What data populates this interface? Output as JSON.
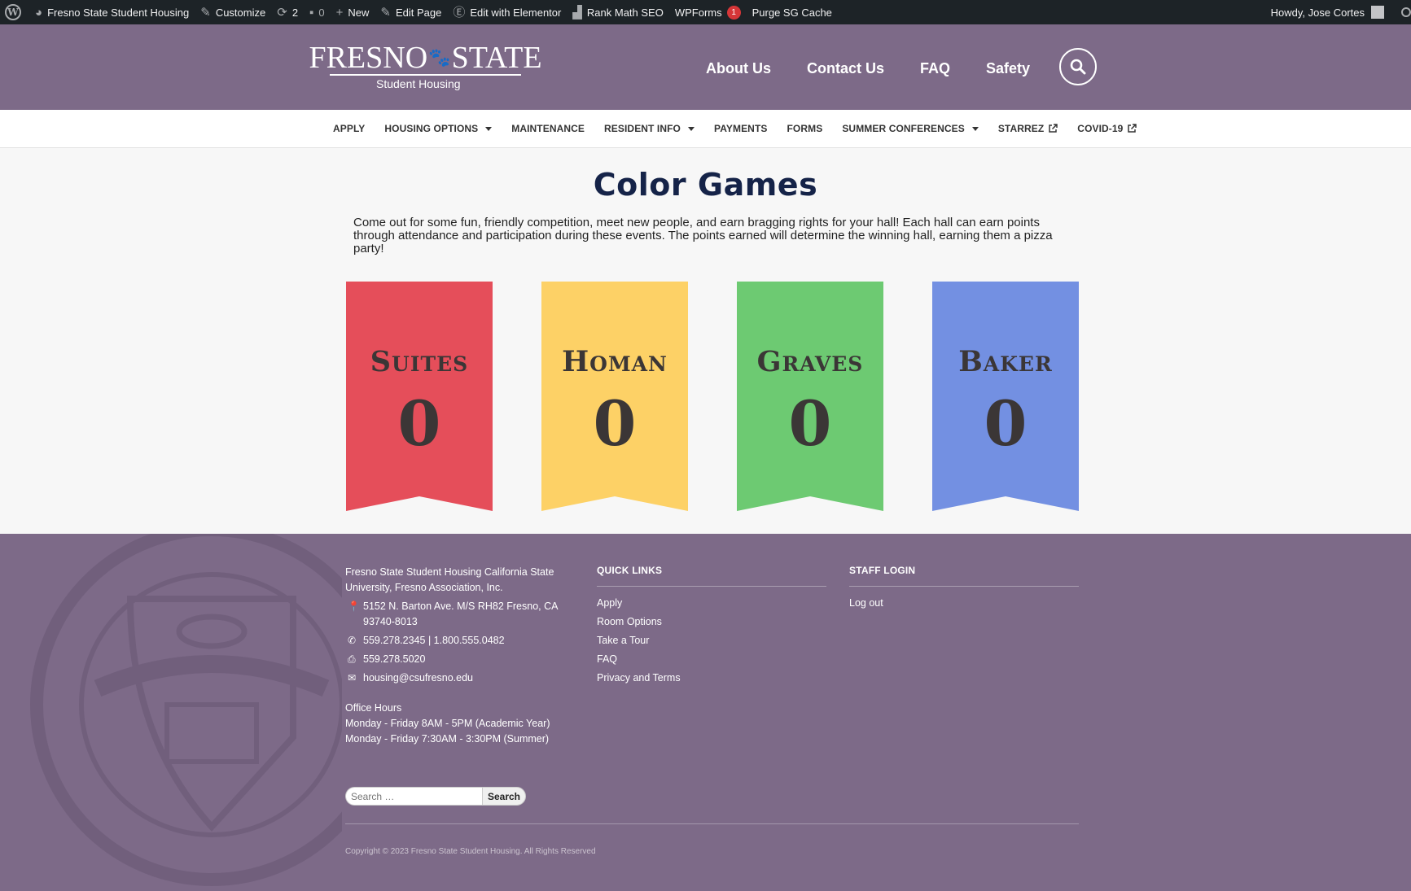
{
  "adminbar": {
    "site_name": "Fresno State Student Housing",
    "customize": "Customize",
    "updates_count": "2",
    "comments_count": "0",
    "new": "New",
    "edit_page": "Edit Page",
    "elementor": "Edit with Elementor",
    "rankmath": "Rank Math SEO",
    "wpforms": "WPForms",
    "wpforms_badge": "1",
    "purge": "Purge SG Cache",
    "howdy": "Howdy, Jose Cortes"
  },
  "logo": {
    "wordmark_left": "FRESNO",
    "wordmark_right": "STATE",
    "sub": "Student Housing"
  },
  "mainnav": [
    "About Us",
    "Contact Us",
    "FAQ",
    "Safety"
  ],
  "subnav": [
    {
      "label": "APPLY",
      "caret": false,
      "ext": false
    },
    {
      "label": "HOUSING OPTIONS",
      "caret": true,
      "ext": false
    },
    {
      "label": "MAINTENANCE",
      "caret": false,
      "ext": false
    },
    {
      "label": "RESIDENT INFO",
      "caret": true,
      "ext": false
    },
    {
      "label": "PAYMENTS",
      "caret": false,
      "ext": false
    },
    {
      "label": "FORMS",
      "caret": false,
      "ext": false
    },
    {
      "label": "SUMMER CONFERENCES",
      "caret": true,
      "ext": false
    },
    {
      "label": "STARREZ",
      "caret": false,
      "ext": true
    },
    {
      "label": "COVID-19",
      "caret": false,
      "ext": true
    }
  ],
  "page": {
    "title": "Color Games",
    "intro": "Come out for some fun, friendly competition, meet new people, and earn bragging rights for your hall! Each hall can earn points through attendance and participation during these events. The points earned will determine the winning hall, earning them a pizza party!"
  },
  "halls": [
    {
      "name": "Suites",
      "score": "0",
      "color": "#e54e5a"
    },
    {
      "name": "Homan",
      "score": "0",
      "color": "#fdd166"
    },
    {
      "name": "Graves",
      "score": "0",
      "color": "#6dca72"
    },
    {
      "name": "Baker",
      "score": "0",
      "color": "#7390e2"
    }
  ],
  "footer": {
    "org": "Fresno State Student Housing California State University, Fresno Association, Inc.",
    "address": "5152 N. Barton Ave. M/S RH82 Fresno, CA 93740-8013",
    "phone": "559.278.2345 | 1.800.555.0482",
    "fax": "559.278.5020",
    "email": "housing@csufresno.edu",
    "hours_title": "Office Hours",
    "hours_1": "Monday - Friday 8AM - 5PM (Academic Year)",
    "hours_2": "Monday - Friday 7:30AM - 3:30PM (Summer)",
    "search_placeholder": "Search …",
    "search_button": "Search",
    "quick_links_title": "QUICK LINKS",
    "quick_links": [
      "Apply",
      "Room Options",
      "Take a Tour",
      "FAQ",
      "Privacy and Terms"
    ],
    "staff_title": "STAFF LOGIN",
    "staff_links": [
      "Log out"
    ],
    "copyright": "Copyright © 2023 Fresno State Student Housing. All Rights Reserved"
  },
  "colors": {
    "header_bg": "#7d6a88",
    "adminbar_bg": "#1d2327",
    "title_color": "#152348"
  }
}
